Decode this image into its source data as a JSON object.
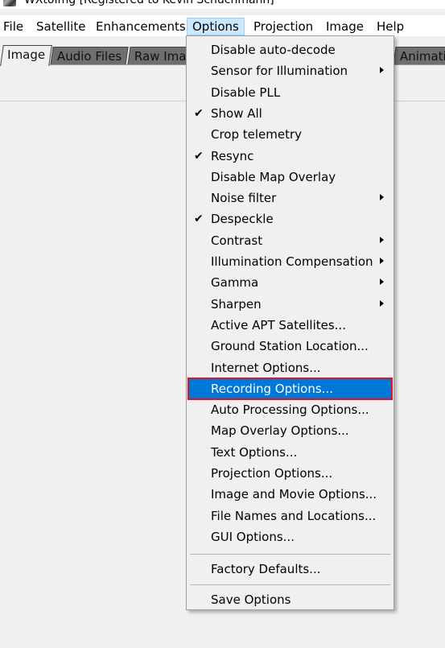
{
  "window": {
    "title": "WXtoImg [Registered to Kevin Schuchmann]"
  },
  "menubar": [
    "File",
    "Satellite",
    "Enhancements",
    "Options",
    "Projection",
    "Image",
    "Help"
  ],
  "tabs": [
    "Image",
    "Audio Files",
    "Raw Ima",
    "Animatio"
  ],
  "options_menu": {
    "items": [
      {
        "label": "Disable auto-decode",
        "checked": false,
        "submenu": false
      },
      {
        "label": "Sensor for Illumination",
        "checked": false,
        "submenu": true
      },
      {
        "label": "Disable PLL",
        "checked": false,
        "submenu": false
      },
      {
        "label": "Show All",
        "checked": true,
        "submenu": false
      },
      {
        "label": "Crop telemetry",
        "checked": false,
        "submenu": false
      },
      {
        "label": "Resync",
        "checked": true,
        "submenu": false
      },
      {
        "label": "Disable Map Overlay",
        "checked": false,
        "submenu": false
      },
      {
        "label": "Noise filter",
        "checked": false,
        "submenu": true
      },
      {
        "label": "Despeckle",
        "checked": true,
        "submenu": false
      },
      {
        "label": "Contrast",
        "checked": false,
        "submenu": true
      },
      {
        "label": "Illumination Compensation",
        "checked": false,
        "submenu": true
      },
      {
        "label": "Gamma",
        "checked": false,
        "submenu": true
      },
      {
        "label": "Sharpen",
        "checked": false,
        "submenu": true
      },
      {
        "label": "Active APT Satellites...",
        "checked": false,
        "submenu": false
      },
      {
        "label": "Ground Station Location...",
        "checked": false,
        "submenu": false
      },
      {
        "label": "Internet Options...",
        "checked": false,
        "submenu": false
      },
      {
        "label": "Recording Options...",
        "checked": false,
        "submenu": false,
        "highlighted": true
      },
      {
        "label": "Auto Processing Options...",
        "checked": false,
        "submenu": false
      },
      {
        "label": "Map Overlay Options...",
        "checked": false,
        "submenu": false
      },
      {
        "label": "Text Options...",
        "checked": false,
        "submenu": false
      },
      {
        "label": "Projection Options...",
        "checked": false,
        "submenu": false
      },
      {
        "label": "Image and Movie Options...",
        "checked": false,
        "submenu": false
      },
      {
        "label": "File Names and Locations...",
        "checked": false,
        "submenu": false
      },
      {
        "label": "GUI Options...",
        "checked": false,
        "submenu": false
      }
    ],
    "factory_defaults": "Factory Defaults...",
    "save_options": "Save Options"
  },
  "colors": {
    "highlight": "#0078d7",
    "highlight_border": "#e81123",
    "menubar_active": "#cce8ff"
  }
}
